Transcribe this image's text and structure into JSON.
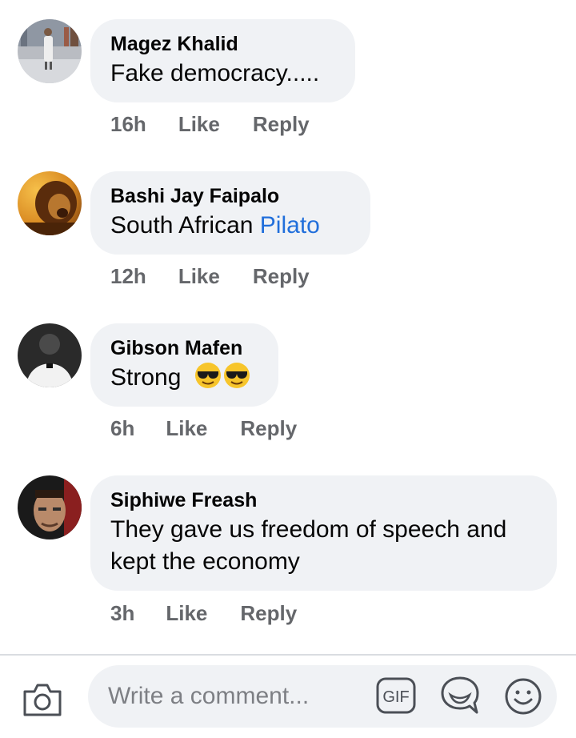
{
  "comments": [
    {
      "author": "Magez Khalid",
      "text": "Fake democracy.....",
      "time": "16h",
      "like": "Like",
      "reply": "Reply"
    },
    {
      "author": "Bashi Jay Faipalo",
      "text": "South African ",
      "mention": "Pilato",
      "time": "12h",
      "like": "Like",
      "reply": "Reply"
    },
    {
      "author": "Gibson Mafen",
      "text": "Strong",
      "emoji": [
        "sunglasses-emoji",
        "sunglasses-emoji"
      ],
      "time": "6h",
      "like": "Like",
      "reply": "Reply"
    },
    {
      "author": "Siphiwe Freash",
      "text": "They gave us freedom of speech and kept the economy",
      "time": "3h",
      "like": "Like",
      "reply": "Reply"
    }
  ],
  "composer": {
    "placeholder": "Write a comment...",
    "icons": [
      "camera-icon",
      "gif-icon",
      "sticker-icon",
      "emoji-icon"
    ]
  },
  "colors": {
    "bubble": "#f0f2f5",
    "mention": "#216fdb",
    "meta": "#65676b"
  }
}
